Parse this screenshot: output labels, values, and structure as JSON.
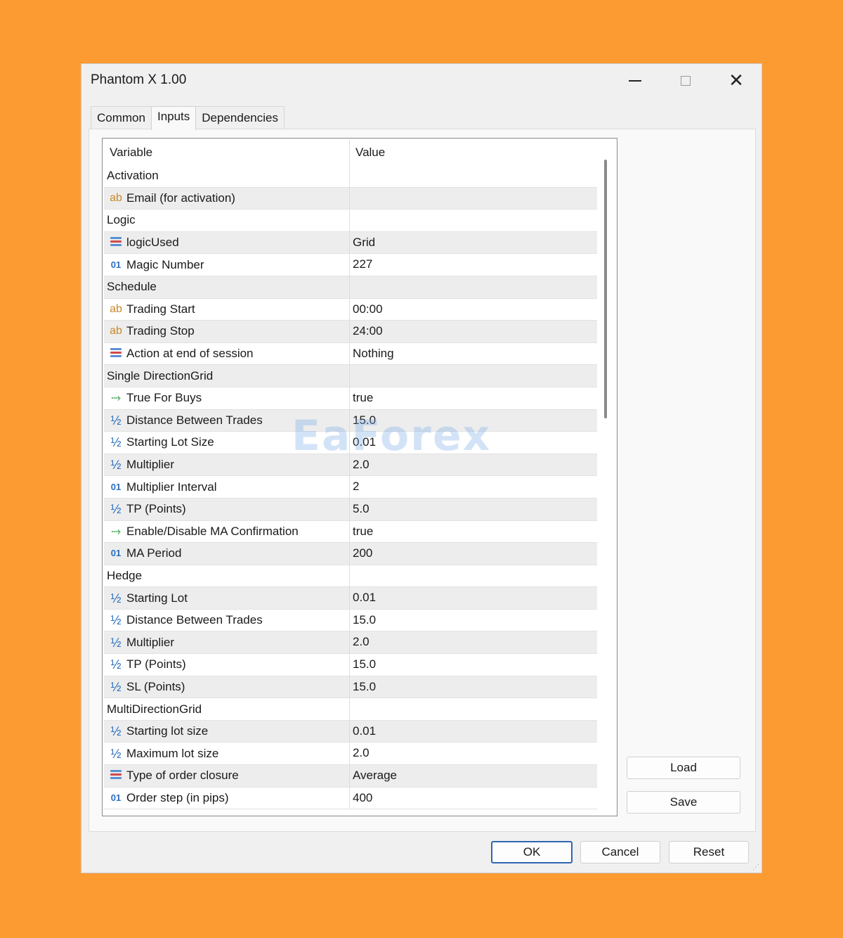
{
  "window": {
    "title": "Phantom X 1.00"
  },
  "tabs": [
    {
      "label": "Common",
      "active": false
    },
    {
      "label": "Inputs",
      "active": true
    },
    {
      "label": "Dependencies",
      "active": false
    }
  ],
  "table": {
    "headers": {
      "variable": "Variable",
      "value": "Value"
    },
    "rows": [
      {
        "icon": "",
        "variable": "Activation",
        "value": ""
      },
      {
        "icon": "string",
        "variable": "Email (for activation)",
        "value": ""
      },
      {
        "icon": "",
        "variable": "Logic",
        "value": ""
      },
      {
        "icon": "enum",
        "variable": "logicUsed",
        "value": "Grid"
      },
      {
        "icon": "int",
        "variable": "Magic Number",
        "value": "227"
      },
      {
        "icon": "",
        "variable": "Schedule",
        "value": ""
      },
      {
        "icon": "string",
        "variable": "Trading Start",
        "value": "00:00"
      },
      {
        "icon": "string",
        "variable": "Trading Stop",
        "value": "24:00"
      },
      {
        "icon": "enum",
        "variable": "Action at end of session",
        "value": "Nothing"
      },
      {
        "icon": "",
        "variable": "Single DirectionGrid",
        "value": ""
      },
      {
        "icon": "bool",
        "variable": "True For Buys",
        "value": "true"
      },
      {
        "icon": "double",
        "variable": "Distance Between Trades",
        "value": "15.0"
      },
      {
        "icon": "double",
        "variable": "Starting Lot Size",
        "value": "0.01"
      },
      {
        "icon": "double",
        "variable": "Multiplier",
        "value": "2.0"
      },
      {
        "icon": "int",
        "variable": "Multiplier Interval",
        "value": "2"
      },
      {
        "icon": "double",
        "variable": "TP (Points)",
        "value": "5.0"
      },
      {
        "icon": "bool",
        "variable": "Enable/Disable MA Confirmation",
        "value": "true"
      },
      {
        "icon": "int",
        "variable": "MA Period",
        "value": "200"
      },
      {
        "icon": "",
        "variable": "Hedge",
        "value": ""
      },
      {
        "icon": "double",
        "variable": "Starting Lot",
        "value": "0.01"
      },
      {
        "icon": "double",
        "variable": "Distance Between Trades",
        "value": "15.0"
      },
      {
        "icon": "double",
        "variable": "Multiplier",
        "value": "2.0"
      },
      {
        "icon": "double",
        "variable": "TP (Points)",
        "value": "15.0"
      },
      {
        "icon": "double",
        "variable": "SL (Points)",
        "value": "15.0"
      },
      {
        "icon": "",
        "variable": "MultiDirectionGrid",
        "value": ""
      },
      {
        "icon": "double",
        "variable": "Starting lot size",
        "value": "0.01"
      },
      {
        "icon": "double",
        "variable": "Maximum lot size",
        "value": "2.0"
      },
      {
        "icon": "enum",
        "variable": "Type of order closure",
        "value": "Average"
      },
      {
        "icon": "int",
        "variable": "Order step (in pips)",
        "value": "400"
      }
    ]
  },
  "icons": {
    "string": "ab",
    "int": "01",
    "double": "½",
    "bool": "⤑",
    "enum": "enum-list-icon"
  },
  "watermark": "EaForex",
  "side_buttons": {
    "load": "Load",
    "save": "Save"
  },
  "footer_buttons": {
    "ok": "OK",
    "cancel": "Cancel",
    "reset": "Reset"
  },
  "colors": {
    "background": "#FD9B33",
    "ok_border": "#2E67B1",
    "string_icon": "#C7882C",
    "number_icon": "#2A6FBF",
    "bool_icon": "#2EA043"
  }
}
